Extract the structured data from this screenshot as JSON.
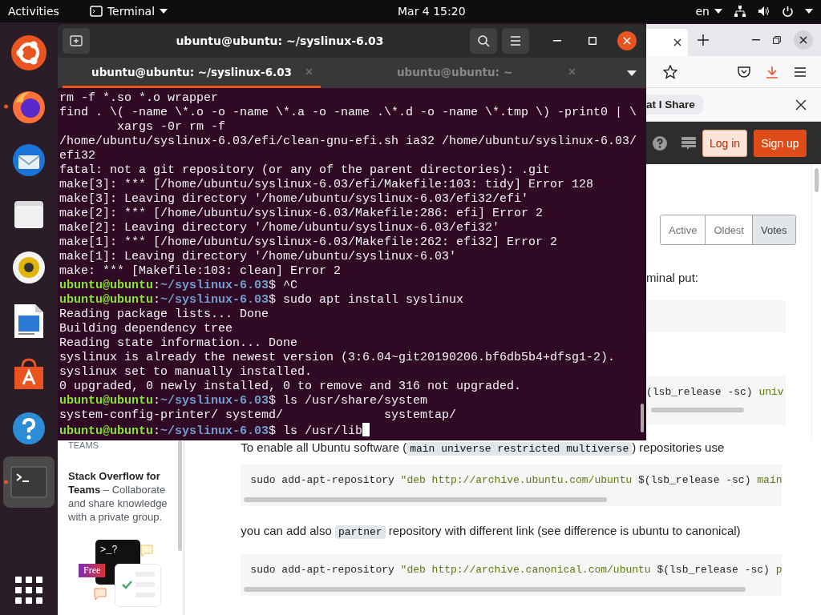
{
  "top_bar": {
    "activities": "Activities",
    "app_menu": "Terminal",
    "clock": "Mar 4  15:20",
    "input_source": "en"
  },
  "dock": [
    {
      "kind": "logo",
      "running": false,
      "selected": false
    },
    {
      "kind": "browser",
      "running": true,
      "selected": false
    },
    {
      "kind": "mail",
      "running": false,
      "selected": false
    },
    {
      "kind": "files",
      "running": false,
      "selected": false
    },
    {
      "kind": "music",
      "running": false,
      "selected": false
    },
    {
      "kind": "writer",
      "running": false,
      "selected": false
    },
    {
      "kind": "store",
      "running": false,
      "selected": false
    },
    {
      "kind": "help",
      "running": false,
      "selected": false
    },
    {
      "kind": "terminal",
      "running": true,
      "selected": true
    }
  ],
  "terminal": {
    "title": "ubuntu@ubuntu: ~/syslinux-6.03",
    "tabs": [
      {
        "label": "ubuntu@ubuntu: ~/syslinux-6.03",
        "selected": true
      },
      {
        "label": "ubuntu@ubuntu: ~",
        "selected": false
      }
    ],
    "lines": [
      {
        "kind": "output",
        "text": "rm -f *.so *.o wrapper"
      },
      {
        "kind": "output",
        "text": "find . \\( -name \\*.o -o -name \\*.a -o -name .\\*.d -o -name \\*.tmp \\) -print0 | \\"
      },
      {
        "kind": "output",
        "text": "        xargs -0r rm -f"
      },
      {
        "kind": "output",
        "text": "/home/ubuntu/syslinux-6.03/efi/clean-gnu-efi.sh ia32 /home/ubuntu/syslinux-6.03/"
      },
      {
        "kind": "output",
        "text": "efi32"
      },
      {
        "kind": "output",
        "text": "fatal: not a git repository (or any of the parent directories): .git"
      },
      {
        "kind": "output",
        "text": "make[3]: *** [/home/ubuntu/syslinux-6.03/efi/Makefile:103: tidy] Error 128"
      },
      {
        "kind": "output",
        "text": "make[3]: Leaving directory '/home/ubuntu/syslinux-6.03/efi32/efi'"
      },
      {
        "kind": "output",
        "text": "make[2]: *** [/home/ubuntu/syslinux-6.03/Makefile:286: efi] Error 2"
      },
      {
        "kind": "output",
        "text": "make[2]: Leaving directory '/home/ubuntu/syslinux-6.03/efi32'"
      },
      {
        "kind": "output",
        "text": "make[1]: *** [/home/ubuntu/syslinux-6.03/Makefile:262: efi32] Error 2"
      },
      {
        "kind": "output",
        "text": "make[1]: Leaving directory '/home/ubuntu/syslinux-6.03'"
      },
      {
        "kind": "output",
        "text": "make: *** [Makefile:103: clean] Error 2"
      },
      {
        "kind": "prompt",
        "user": "ubuntu@ubuntu",
        "separator": ":",
        "path": "~/syslinux-6.03",
        "command": "$ ^C"
      },
      {
        "kind": "prompt",
        "user": "ubuntu@ubuntu",
        "separator": ":",
        "path": "~/syslinux-6.03",
        "command": "$ sudo apt install syslinux"
      },
      {
        "kind": "output",
        "text": "Reading package lists... Done"
      },
      {
        "kind": "output",
        "text": "Building dependency tree"
      },
      {
        "kind": "output",
        "text": "Reading state information... Done"
      },
      {
        "kind": "output",
        "text": "syslinux is already the newest version (3:6.04~git20190206.bf6db5b4+dfsg1-2)."
      },
      {
        "kind": "output",
        "text": "syslinux set to manually installed."
      },
      {
        "kind": "output",
        "text": "0 upgraded, 0 newly installed, 0 to remove and 316 not upgraded."
      },
      {
        "kind": "prompt",
        "user": "ubuntu@ubuntu",
        "separator": ":",
        "path": "~/syslinux-6.03",
        "command": "$ ls /usr/share/system"
      },
      {
        "kind": "output",
        "text": "system-config-printer/ systemd/              systemtap/"
      },
      {
        "kind": "prompt",
        "user": "ubuntu@ubuntu",
        "separator": ":",
        "path": "~/syslinux-6.03",
        "command": "$ ls /usr/lib"
      }
    ]
  },
  "browser": {
    "notification": "at I Share",
    "header_buttons": [
      {
        "label": "Log in",
        "kind": "secondary"
      },
      {
        "label": "Sign up",
        "kind": "primary"
      }
    ],
    "sort_tabs": [
      {
        "label": "Active",
        "selected": false
      },
      {
        "label": "Oldest",
        "selected": false
      },
      {
        "label": "Votes",
        "selected": true
      }
    ],
    "answer_intro": "minal put:",
    "code_partial": [
      {
        "kind": "plain",
        "text": "(lsb_release -sc) "
      },
      {
        "kind": "string",
        "text": "univ"
      }
    ],
    "sidebar": {
      "section": "TEAMS",
      "promo": "**Stack Overflow for Teams** – Collaborate and share knowledge with a private group.",
      "illustration_prompt": ">_?",
      "badge": "Free"
    },
    "blocks": [
      {
        "kind": "text",
        "segments": [
          {
            "kind": "text",
            "text": "To enable all Ubuntu software ("
          },
          {
            "kind": "code",
            "text": "main universe restricted multiverse"
          },
          {
            "kind": "text",
            "text": ") repositories use"
          }
        ]
      },
      {
        "kind": "code",
        "segments": [
          {
            "kind": "plain",
            "text": "sudo add-apt-repository "
          },
          {
            "kind": "string",
            "text": "\"deb http://archive.ubuntu.com/ubuntu"
          },
          {
            "kind": "plain",
            "text": " $(lsb_release -sc) "
          },
          {
            "kind": "string",
            "text": "main"
          }
        ]
      },
      {
        "kind": "text",
        "segments": [
          {
            "kind": "text",
            "text": "you can add also "
          },
          {
            "kind": "code",
            "text": "partner"
          },
          {
            "kind": "text",
            "text": " repository with different link (see difference is ubuntu to canonical)"
          }
        ]
      },
      {
        "kind": "code",
        "segments": [
          {
            "kind": "plain",
            "text": "sudo add-apt-repository "
          },
          {
            "kind": "string",
            "text": "\"deb http://archive.canonical.com/ubuntu"
          },
          {
            "kind": "plain",
            "text": " $(lsb_release -sc) "
          },
          {
            "kind": "string",
            "text": "p"
          }
        ]
      }
    ]
  }
}
